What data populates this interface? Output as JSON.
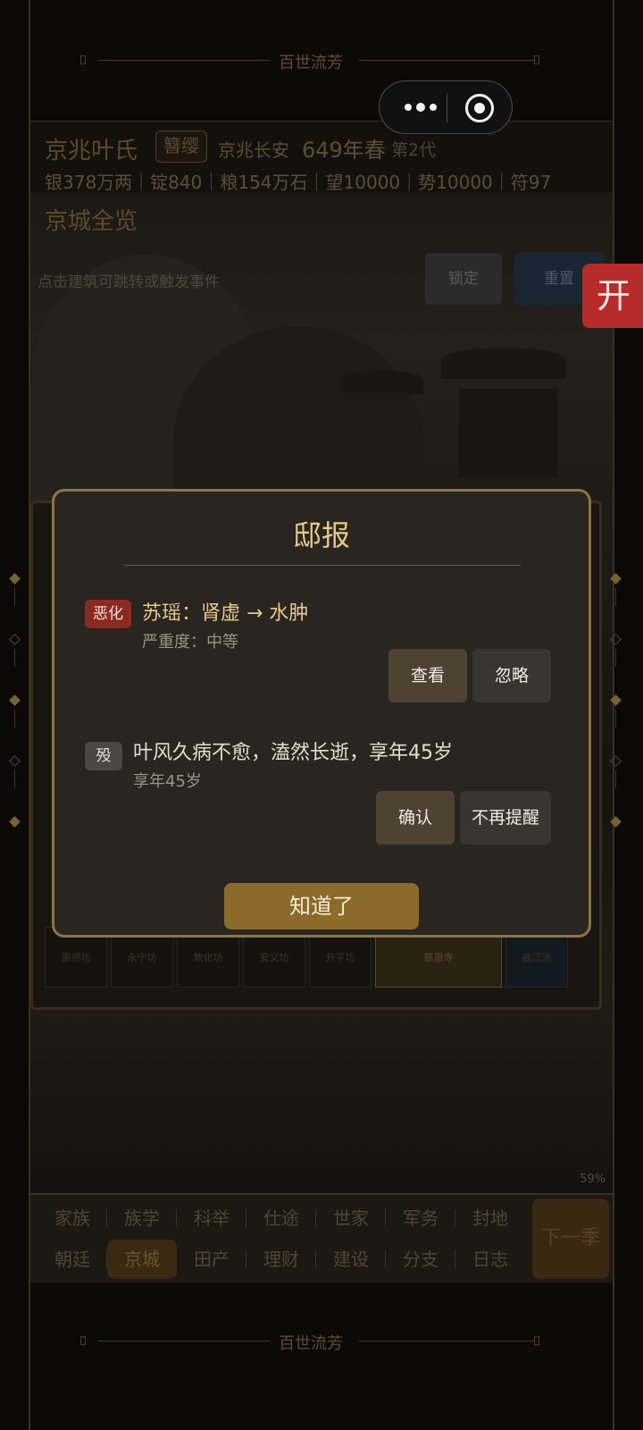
{
  "banner": {
    "title": "百世流芳"
  },
  "status": {
    "family_name": "京兆叶氏",
    "rank": "簪缨",
    "location": "京兆长安",
    "year": "649年春",
    "generation": "第2代",
    "resources": "银378万两｜锭840｜粮154万石｜望10000｜势10000｜符97"
  },
  "scene": {
    "title": "京城全览",
    "hint": "点击建筑可跳转或触发事件",
    "lock_label": "锁定",
    "reset_label": "重置",
    "cells": [
      "崇贤坊",
      "永宁坊",
      "敦化坊",
      "安义坊",
      "升平坊",
      "慈恩寺",
      "曲江池"
    ],
    "percent": "59%"
  },
  "open_button": {
    "label": "开"
  },
  "nav": {
    "row1": [
      "家族",
      "族学",
      "科举",
      "仕途",
      "世家",
      "军务",
      "封地"
    ],
    "row2": [
      "朝廷",
      "京城",
      "田产",
      "理财",
      "建设",
      "分支",
      "日志"
    ],
    "active": "京城",
    "next_label": "下一季"
  },
  "modal": {
    "title": "邸报",
    "events": [
      {
        "tag": "恶化",
        "title": "苏瑶：肾虚 → 水肿",
        "subtitle": "严重度：中等",
        "primary": "查看",
        "secondary": "忽略"
      },
      {
        "tag": "殁",
        "title": "叶风久病不愈，溘然长逝，享年45岁",
        "subtitle": "享年45岁",
        "primary": "确认",
        "secondary": "不再提醒"
      }
    ],
    "ok_label": "知道了"
  },
  "colors": {
    "accent_gold": "#8b6a2a",
    "modal_border": "#8c7446",
    "tag_red": "#8c2a22",
    "open_red": "#b82b2b"
  }
}
